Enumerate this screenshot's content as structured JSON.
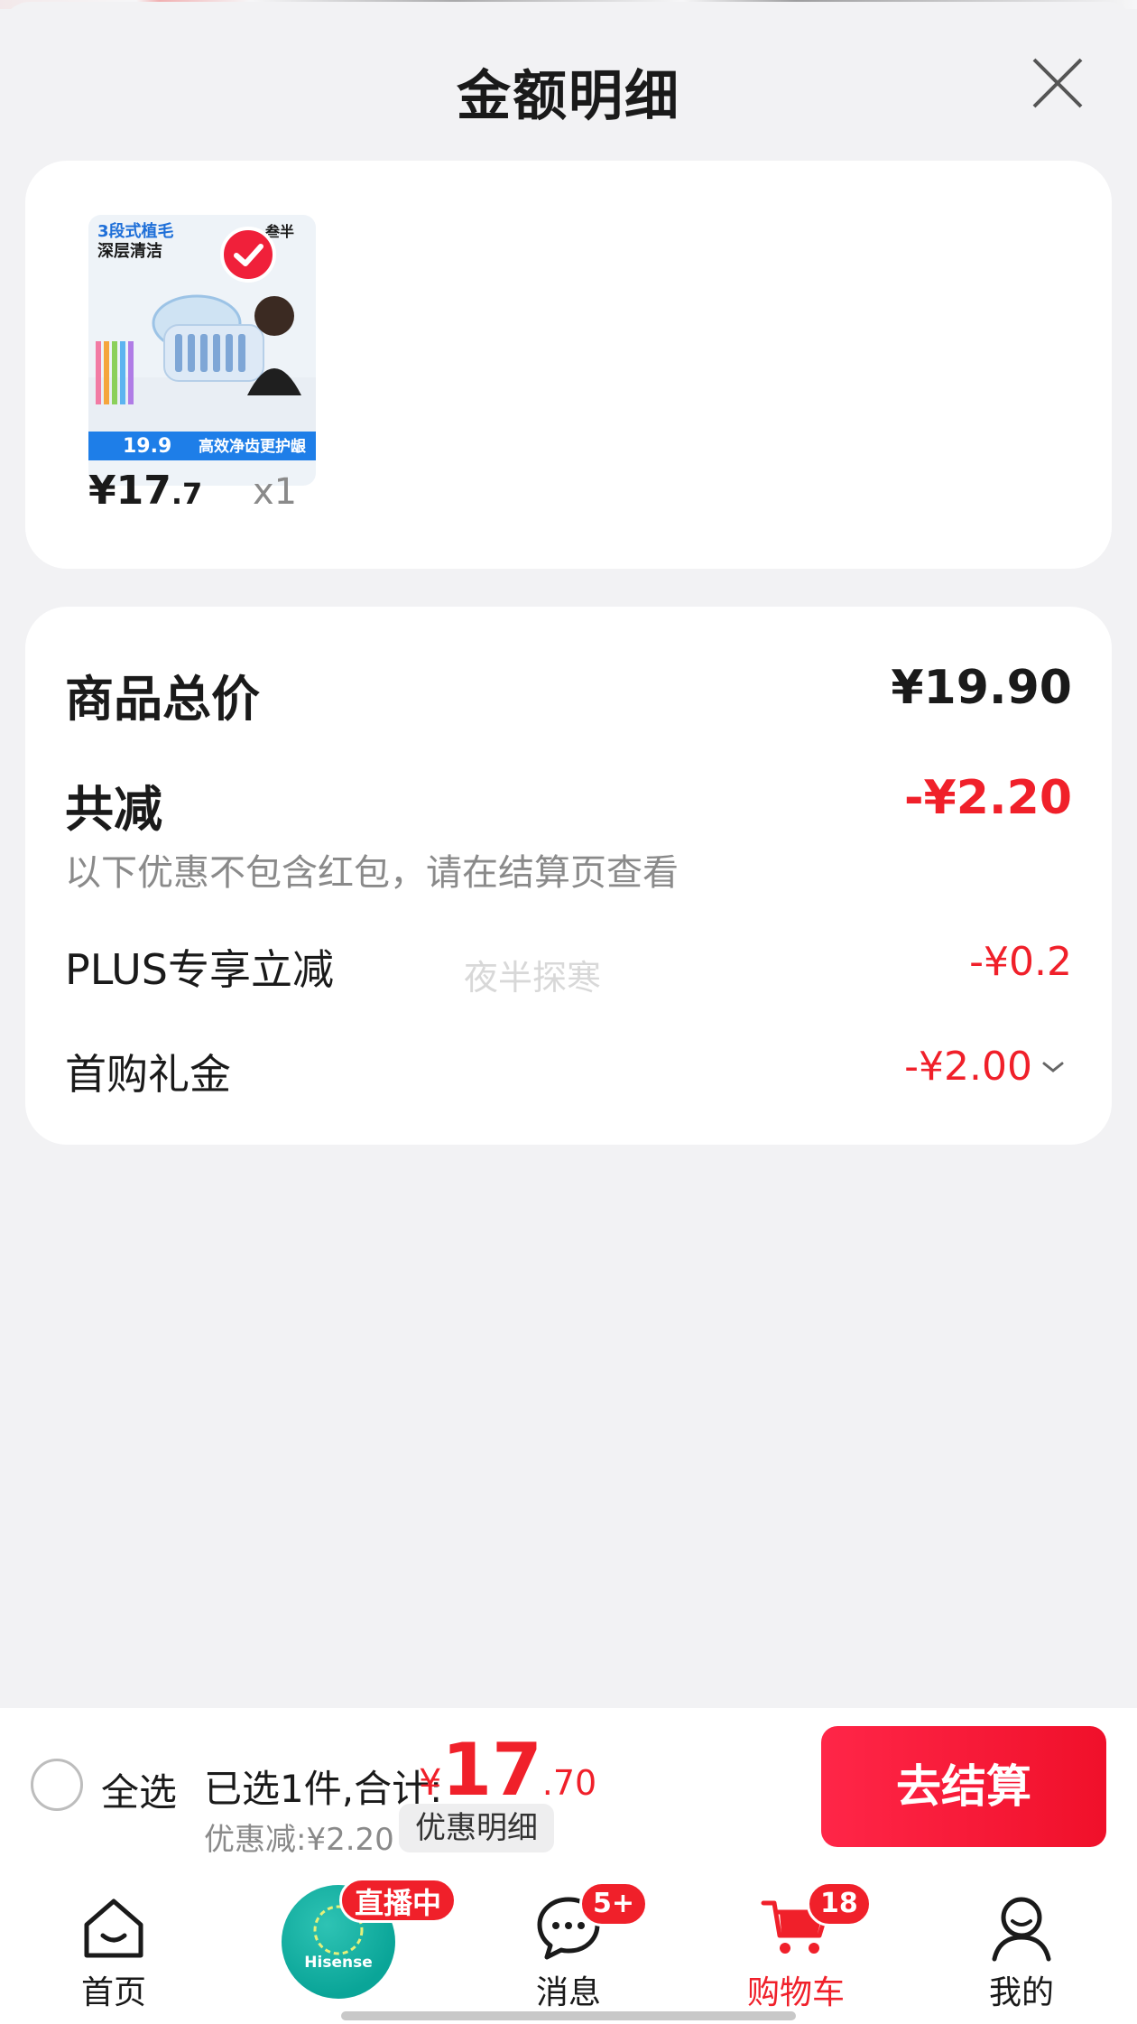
{
  "sheet": {
    "title": "金额明细"
  },
  "product": {
    "thumbnail": {
      "headline": "3段式植毛",
      "subhead": "深层清洁",
      "brand": "叁半",
      "promo_price": "19.9",
      "slogan": "高效净齿更护龈"
    },
    "price_int": "¥17",
    "price_dec": ".7",
    "qty": "x1"
  },
  "summary": {
    "total_label": "商品总价",
    "total_value": "¥19.90",
    "reduce_label": "共减",
    "reduce_value": "-¥2.20",
    "reduce_note": "以下优惠不包含红包，请在结算页查看",
    "plus_label": "PLUS专享立减",
    "plus_value": "-¥0.2",
    "gift_label": "首购礼金",
    "gift_value": "-¥2.00",
    "watermark": "夜半探寒"
  },
  "checkout": {
    "select_all": "全选",
    "selected_summary": "已选1件,合计:",
    "currency": "¥",
    "amount_int": "17",
    "amount_dec": ".70",
    "discount_text": "优惠减:¥2.20",
    "discount_detail": "优惠明细",
    "checkout_button": "去结算"
  },
  "tabbar": {
    "items": [
      {
        "label": "首页",
        "icon": "home-icon"
      },
      {
        "label": "直播中",
        "icon": "live-avatar",
        "brand": "Hisense"
      },
      {
        "label": "消息",
        "icon": "message-icon",
        "badge": "5+"
      },
      {
        "label": "购物车",
        "icon": "cart-icon",
        "badge": "18",
        "active": true
      },
      {
        "label": "我的",
        "icon": "user-icon"
      }
    ]
  },
  "colors": {
    "accent": "#f0202a",
    "card": "#ffffff",
    "background": "#f2f2f4",
    "live_teal": "#0aa598"
  }
}
